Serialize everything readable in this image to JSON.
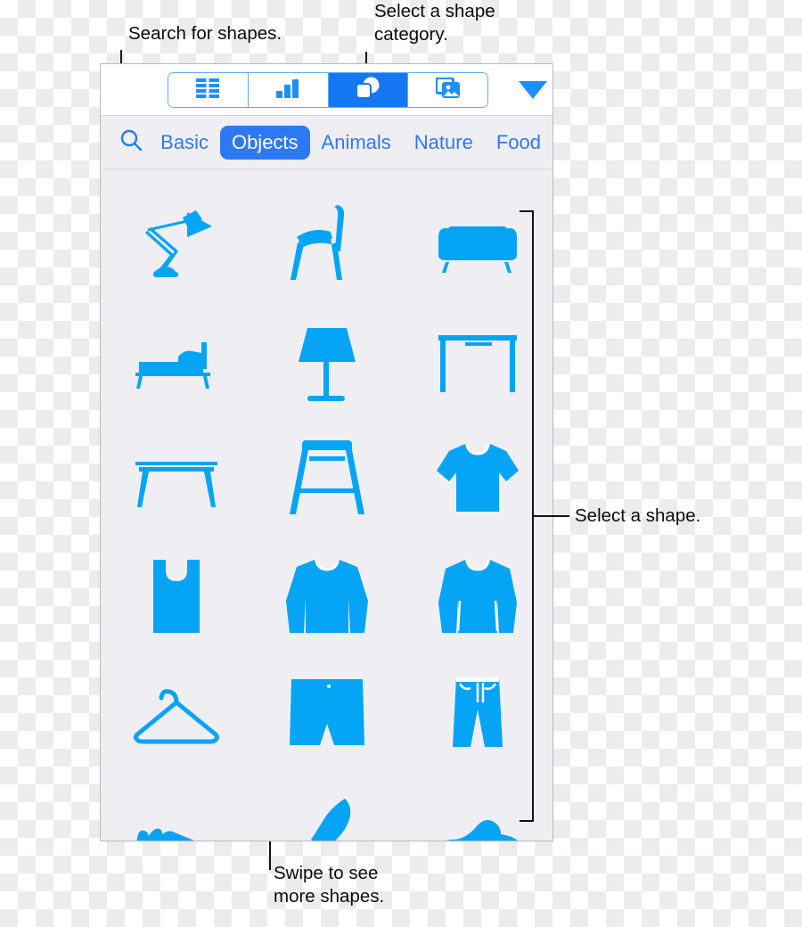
{
  "accent": {
    "ui_blue": "#2d79f3",
    "segment_blue": "#1577f2",
    "shape_blue": "#06a4f5",
    "panel_bg": "#eeeef3",
    "checker": "#ececec"
  },
  "annotations": [
    {
      "id": "search-callout",
      "text": "Search for shapes."
    },
    {
      "id": "category-callout",
      "text": "Select a shape\ncategory."
    },
    {
      "id": "shape-callout",
      "text": "Select a shape."
    },
    {
      "id": "swipe-callout",
      "text": "Swipe to see\nmore shapes."
    }
  ],
  "toolbar": {
    "segments": [
      {
        "icon": "table-icon",
        "label": "Table",
        "selected": false
      },
      {
        "icon": "chart-icon",
        "label": "Chart",
        "selected": false
      },
      {
        "icon": "shapes-icon",
        "label": "Shapes",
        "selected": true
      },
      {
        "icon": "media-icon",
        "label": "Media",
        "selected": false
      }
    ],
    "chevron": {
      "icon": "chevron-down-icon",
      "label": "Collapse"
    }
  },
  "categories": {
    "search_icon": "search-icon",
    "items": [
      {
        "label": "Basic",
        "selected": false
      },
      {
        "label": "Objects",
        "selected": true
      },
      {
        "label": "Animals",
        "selected": false
      },
      {
        "label": "Nature",
        "selected": false
      },
      {
        "label": "Food",
        "selected": false
      }
    ]
  },
  "shapes": {
    "rows": [
      [
        "desk-lamp",
        "chair",
        "sofa"
      ],
      [
        "bed",
        "table-lamp",
        "desk"
      ],
      [
        "coffee-table",
        "bar-stool",
        "t-shirt"
      ],
      [
        "tank-top",
        "sweatshirt",
        "sweater"
      ],
      [
        "clothes-hanger",
        "shorts",
        "jeans"
      ],
      [
        "sneaker",
        "high-heel-shoe",
        "dress-shoe"
      ]
    ]
  }
}
